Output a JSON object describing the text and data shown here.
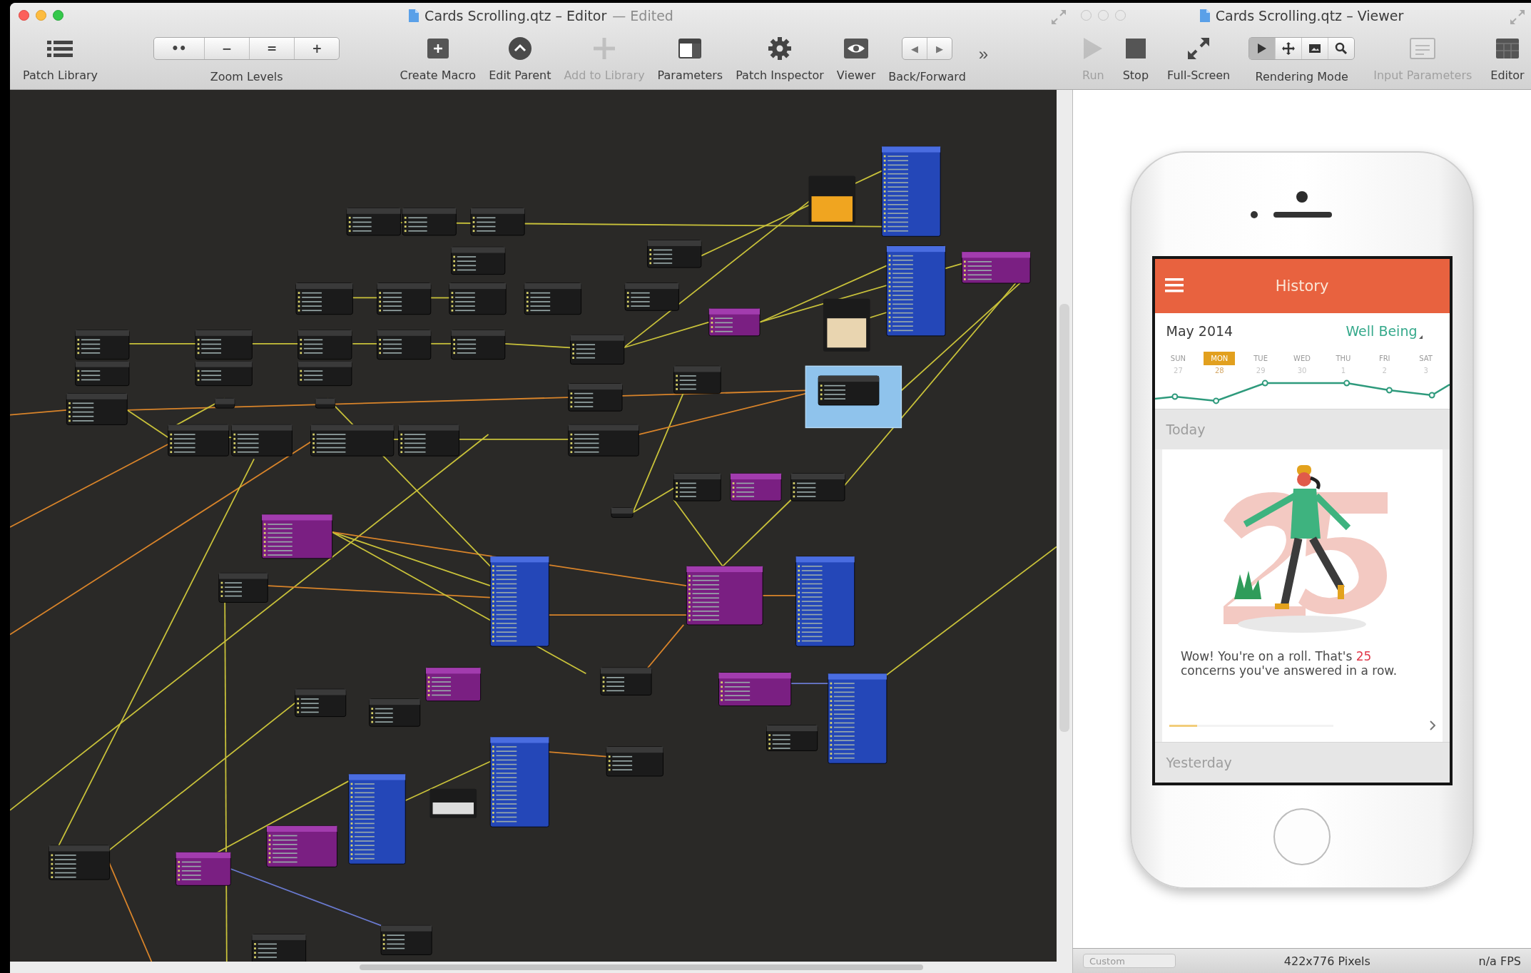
{
  "editor": {
    "title": "Cards Scrolling.qtz – Editor",
    "edited": "— Edited",
    "toolbar": [
      {
        "kind": "button",
        "label": "Patch Library",
        "disabled": false
      },
      {
        "kind": "segmented",
        "label": "Zoom Levels",
        "segments": [
          "••",
          "−",
          "=",
          "+"
        ]
      },
      {
        "kind": "button",
        "label": "Create Macro",
        "disabled": false
      },
      {
        "kind": "button",
        "label": "Edit Parent",
        "disabled": false
      },
      {
        "kind": "button",
        "label": "Add to Library",
        "disabled": true
      },
      {
        "kind": "button",
        "label": "Parameters",
        "disabled": false
      },
      {
        "kind": "button",
        "label": "Patch Inspector",
        "disabled": false
      },
      {
        "kind": "button",
        "label": "Viewer",
        "disabled": false
      },
      {
        "kind": "segmented",
        "label": "Back/Forward",
        "segments": [
          "◀",
          "▶"
        ]
      },
      {
        "kind": "overflow",
        "label": "»"
      }
    ]
  },
  "viewer": {
    "title": "Cards Scrolling.qtz – Viewer",
    "toolbar": [
      {
        "kind": "button",
        "label": "Run",
        "disabled": true
      },
      {
        "kind": "button",
        "label": "Stop",
        "disabled": false
      },
      {
        "kind": "button",
        "label": "Full-Screen",
        "disabled": false
      },
      {
        "kind": "modes",
        "label": "Rendering Mode",
        "modes": [
          {
            "selected": true
          },
          {
            "selected": false
          },
          {
            "selected": false
          },
          {
            "selected": false
          }
        ]
      },
      {
        "kind": "button",
        "label": "Input Parameters",
        "disabled": true
      },
      {
        "kind": "button",
        "label": "Editor",
        "disabled": false
      }
    ],
    "app": {
      "header": "History",
      "month": "May 2014",
      "metric": "Well Being",
      "days": [
        {
          "label": "SUN",
          "date": "27",
          "selected": false
        },
        {
          "label": "MON",
          "date": "28",
          "selected": true
        },
        {
          "label": "TUE",
          "date": "29",
          "selected": false
        },
        {
          "label": "WED",
          "date": "30",
          "selected": false
        },
        {
          "label": "THU",
          "date": "1",
          "selected": false
        },
        {
          "label": "FRI",
          "date": "2",
          "selected": false
        },
        {
          "label": "SAT",
          "date": "3",
          "selected": false
        }
      ],
      "sections": [
        {
          "title": "Today",
          "card": {
            "message": [
              {
                "text": "Wow! You're on a roll. That's ",
                "highlight": false
              },
              {
                "text": "25",
                "highlight": true
              },
              {
                "text": " concerns you've answered in a row.",
                "highlight": false
              }
            ],
            "progress": {
              "level": 0.17
            }
          }
        },
        {
          "title": "Yesterday"
        }
      ]
    },
    "status_bar": {
      "size_menu": "Custom",
      "resolution": "422x776 Pixels",
      "fps": "n/a FPS"
    }
  }
}
